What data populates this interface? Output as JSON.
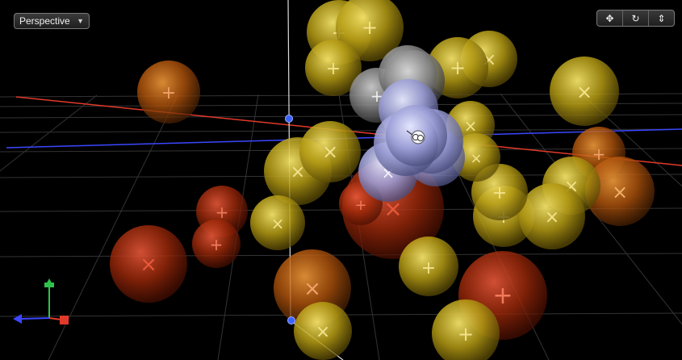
{
  "viewport": {
    "camera_menu": {
      "selected": "Perspective",
      "caret_icon": "triangle-down-icon"
    },
    "nav_controls": [
      {
        "name": "pan-icon",
        "glyph": "✥"
      },
      {
        "name": "orbit-icon",
        "glyph": "↻"
      },
      {
        "name": "dolly-icon",
        "glyph": "⇕"
      }
    ]
  },
  "colors": {
    "background": "#000000",
    "particle_yellow": "#c9b11a",
    "particle_red": "#c2330d",
    "particle_orange": "#d46a10",
    "particle_lavender": "#9fa3e0",
    "axis_x_red": "#e23a2a",
    "axis_z_blue": "#3b47ff",
    "axis_y_green": "#2fc24a",
    "grid": "#3a3a3a"
  }
}
